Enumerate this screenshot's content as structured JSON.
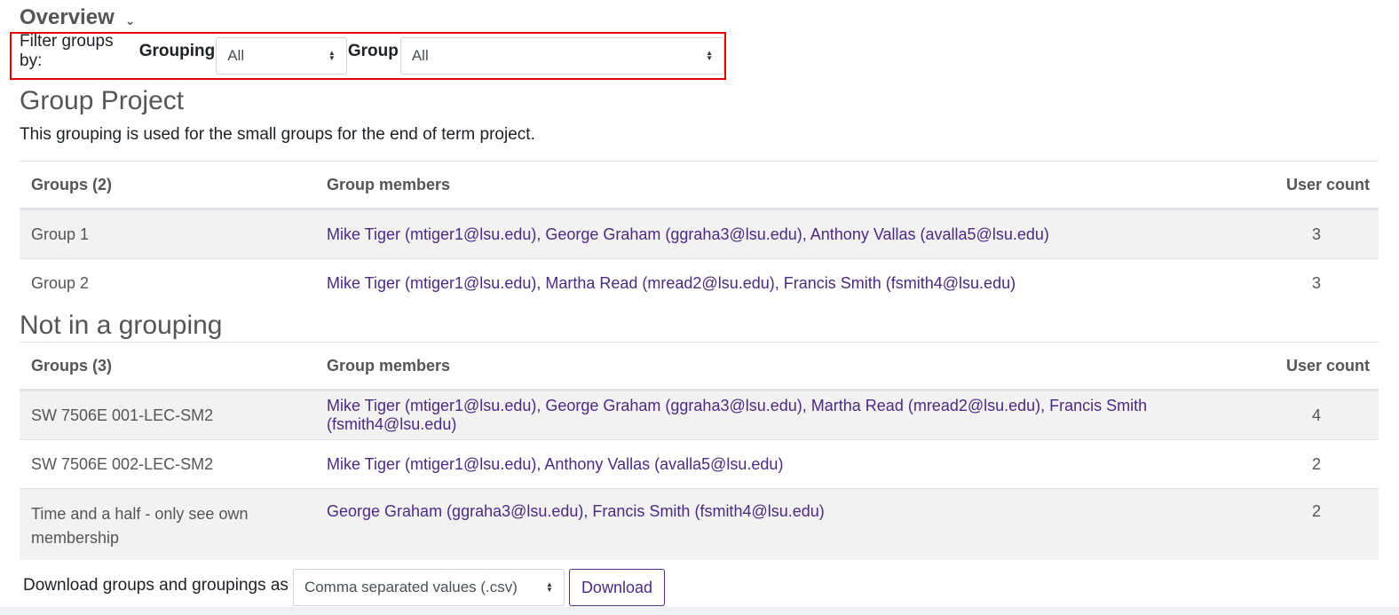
{
  "header": {
    "title": "Overview"
  },
  "filter": {
    "label": "Filter groups by:",
    "grouping_label": "Grouping",
    "grouping_value": "All",
    "group_label": "Group",
    "group_value": "All"
  },
  "grouping1": {
    "title": "Group Project",
    "description": "This grouping is used for the small groups for the end of term project.",
    "columns": [
      "Groups (2)",
      "Group members",
      "User count"
    ],
    "rows": [
      {
        "group": "Group 1",
        "members": "Mike Tiger (mtiger1@lsu.edu), George Graham (ggraha3@lsu.edu), Anthony Vallas (avalla5@lsu.edu)",
        "count": "3"
      },
      {
        "group": "Group 2",
        "members": "Mike Tiger (mtiger1@lsu.edu), Martha Read (mread2@lsu.edu), Francis Smith (fsmith4@lsu.edu)",
        "count": "3"
      }
    ]
  },
  "grouping2": {
    "title": "Not in a grouping",
    "columns": [
      "Groups (3)",
      "Group members",
      "User count"
    ],
    "rows": [
      {
        "group": "SW 7506E 001-LEC-SM2",
        "members": "Mike Tiger (mtiger1@lsu.edu), George Graham (ggraha3@lsu.edu), Martha Read (mread2@lsu.edu), Francis Smith (fsmith4@lsu.edu)",
        "count": "4"
      },
      {
        "group": "SW 7506E 002-LEC-SM2",
        "members": "Mike Tiger (mtiger1@lsu.edu), Anthony Vallas (avalla5@lsu.edu)",
        "count": "2"
      },
      {
        "group": "Time and a half - only see own membership",
        "members": "George Graham (ggraha3@lsu.edu), Francis Smith (fsmith4@lsu.edu)",
        "count": "2"
      }
    ]
  },
  "download": {
    "label": "Download groups and groupings as",
    "format_value": "Comma separated values (.csv)",
    "button_label": "Download"
  },
  "colors": {
    "accent": "#4b2a82",
    "highlight_border": "#e00000"
  }
}
